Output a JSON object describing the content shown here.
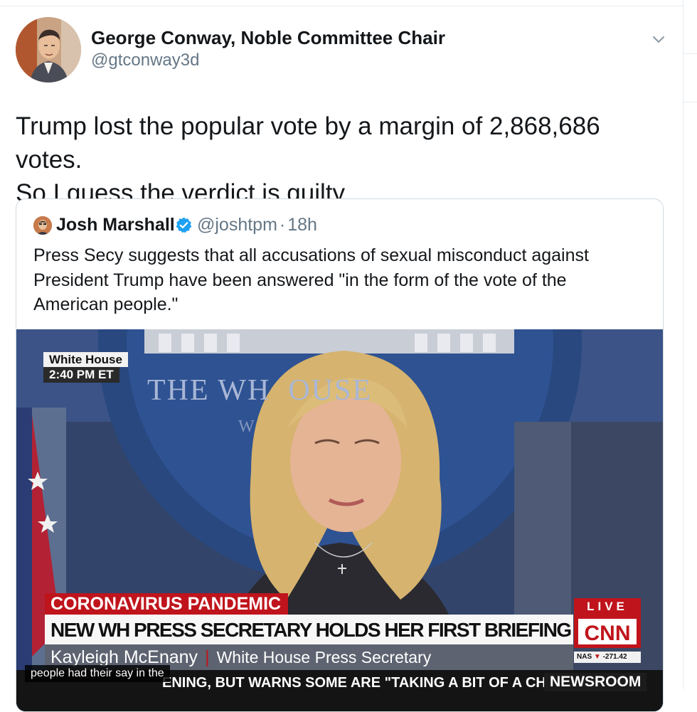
{
  "tweet": {
    "display_name": "George Conway, Noble Committee Chair",
    "handle": "@gtconway3d",
    "text_line1": "Trump lost the popular vote by a margin of 2,868,686 votes.",
    "text_line2": "So I guess the verdict is guilty.",
    "menu_icon": "chevron-down-icon"
  },
  "quoted_tweet": {
    "display_name": "Josh Marshall",
    "verified_icon": "verified-badge-icon",
    "handle": "@joshtpm",
    "separator": "·",
    "time": "18h",
    "text": "Press Secy suggests that all accusations of sexual misconduct against President Trump have been answered \"in the form of the vote of the American people.\""
  },
  "video": {
    "location_bug": "White House",
    "time_bug": "2:40 PM ET",
    "backdrop_text": "THE WH  OUSE",
    "backdrop_sub": "W",
    "headline_tag": "CORONAVIRUS PANDEMIC",
    "headline": "NEW WH PRESS SECRETARY HOLDS HER FIRST BRIEFING AMID PANDEMIC",
    "speaker_name": "Kayleigh McEnany",
    "speaker_title": "White House Press Secretary",
    "live_label": "LIVE",
    "network": "CNN",
    "market_label": "NAS",
    "market_value": "-271.42",
    "ticker_text": "ENING, BUT WARNS SOME ARE \"TAKING A BIT OF A CHA",
    "program": "NEWSROOM",
    "caption": "people had their say in the",
    "colors": {
      "cnn_red": "#c0141c",
      "lower_third_grey": "#5d6370",
      "backdrop_blue": "#2d4a83"
    }
  }
}
